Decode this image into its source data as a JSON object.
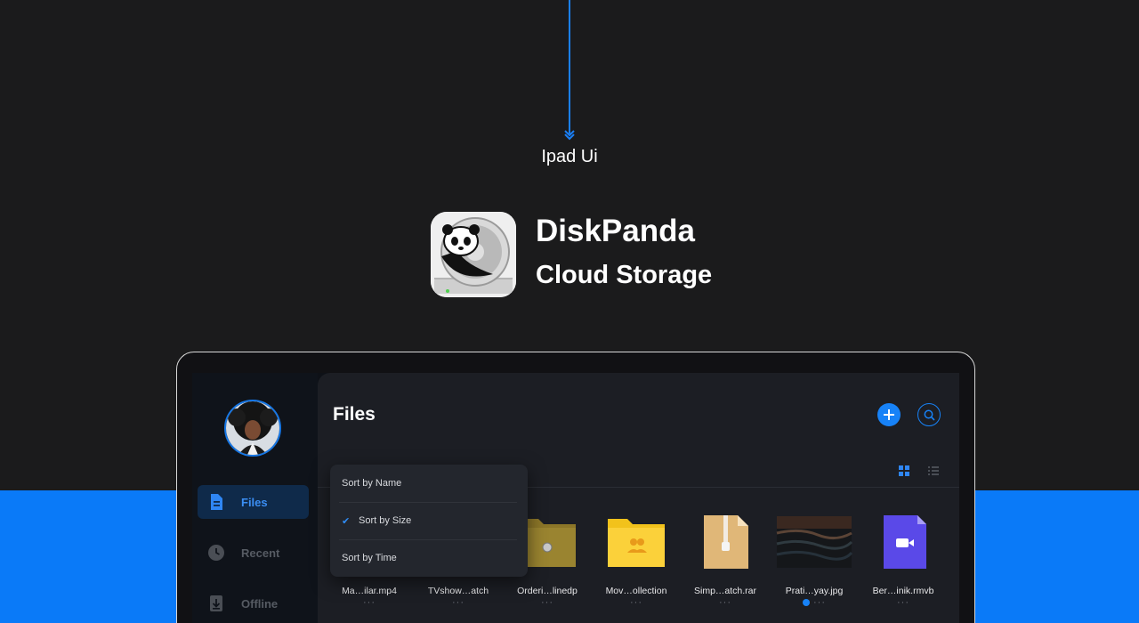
{
  "pointer": {
    "label": "Ipad Ui"
  },
  "brand": {
    "title": "DiskPanda",
    "subtitle": "Cloud Storage"
  },
  "colors": {
    "accent": "#1782f7",
    "band": "#0a7af8",
    "background": "#1b1b1c"
  },
  "sidebar": {
    "items": [
      {
        "label": "Files",
        "icon": "document-icon",
        "active": true
      },
      {
        "label": "Recent",
        "icon": "clock-icon",
        "active": false
      },
      {
        "label": "Offline",
        "icon": "download-icon",
        "active": false
      }
    ]
  },
  "main": {
    "title": "Files",
    "sort_menu": {
      "items": [
        {
          "label": "Sort by Name",
          "checked": false
        },
        {
          "label": "Sort by Size",
          "checked": true
        },
        {
          "label": "Sort by Time",
          "checked": false
        }
      ]
    },
    "files": [
      {
        "name": "Ma…ilar.mp4",
        "more": "···"
      },
      {
        "name": "TVshow…atch",
        "more": "···"
      },
      {
        "name": "Orderi…linedp",
        "more": "···"
      },
      {
        "name": "Mov…ollection",
        "more": "···"
      },
      {
        "name": "Simp…atch.rar",
        "more": "···"
      },
      {
        "name": "Prati…yay.jpg",
        "more": "···"
      },
      {
        "name": "Ber…inik.rmvb",
        "more": "···"
      }
    ]
  }
}
